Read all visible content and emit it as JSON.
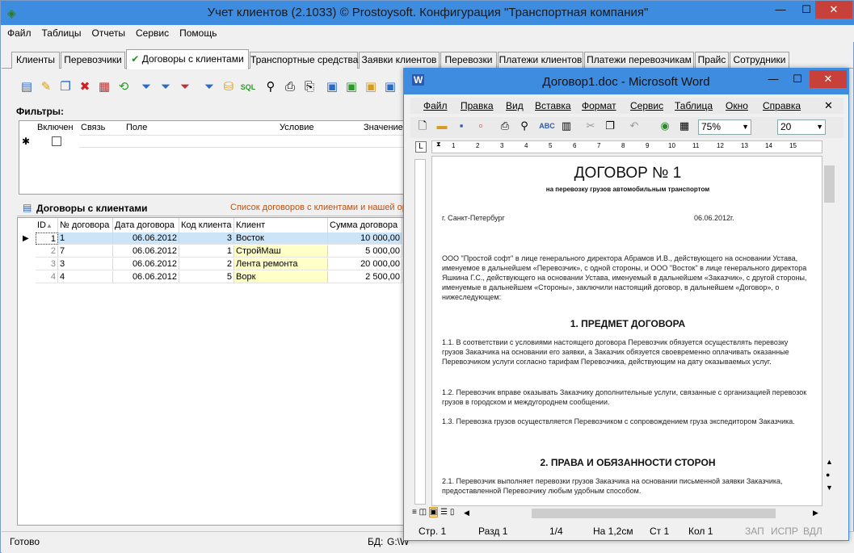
{
  "main_window": {
    "title": "Учет клиентов (2.1033) © Prostoysoft. Конфигурация \"Транспортная компания\"",
    "controls": {
      "minimize": "—",
      "maximize": "☐",
      "close": "✕"
    },
    "menu": [
      "Файл",
      "Таблицы",
      "Отчеты",
      "Сервис",
      "Помощь"
    ],
    "tabs": [
      "Клиенты",
      "Перевозчики",
      "Договоры с клиентами",
      "Транспортные средства",
      "Заявки клиентов",
      "Перевозки",
      "Платежи клиентов",
      "Платежи перевозчикам",
      "Прайс",
      "Сотрудники"
    ],
    "active_tab_check": "✔",
    "filters": {
      "label": "Фильтры:",
      "columns": [
        "Включен",
        "Связь",
        "Поле",
        "Условие",
        "Значение"
      ],
      "new_row_marker": "✱"
    },
    "grid": {
      "title": "Договоры с клиентами",
      "subtitle": "Список договоров с клиентами и нашей ор",
      "columns": [
        "ID",
        "№ договора",
        "Дата договора",
        "Код клиента",
        "Клиент",
        "Сумма договора"
      ],
      "sort_indicator": "▲",
      "rows": [
        {
          "id": "1",
          "num": "1",
          "date": "06.06.2012",
          "code": "3",
          "client": "Восток",
          "sum": "10 000,00"
        },
        {
          "id": "2",
          "num": "7",
          "date": "06.06.2012",
          "code": "1",
          "client": "СтройМаш",
          "sum": "5 000,00"
        },
        {
          "id": "3",
          "num": "3",
          "date": "06.06.2012",
          "code": "2",
          "client": "Лента ремонта",
          "sum": "20 000,00"
        },
        {
          "id": "4",
          "num": "4",
          "date": "06.06.2012",
          "code": "5",
          "client": "Ворк",
          "sum": "2 500,00"
        }
      ],
      "current_row_marker": "▶"
    },
    "status": {
      "ready": "Готово",
      "db_label": "БД:",
      "db_value": "G:\\W"
    }
  },
  "word_window": {
    "title": "Договор1.doc - Microsoft Word",
    "menu": [
      "Файл",
      "Правка",
      "Вид",
      "Вставка",
      "Формат",
      "Сервис",
      "Таблица",
      "Окно",
      "Справка"
    ],
    "zoom": "75%",
    "font_size": "20",
    "ruler_numbers": [
      "1",
      "2",
      "3",
      "4",
      "5",
      "6",
      "7",
      "8",
      "9",
      "10",
      "11",
      "12",
      "13",
      "14",
      "15"
    ],
    "document": {
      "title": "ДОГОВОР № 1",
      "subtitle": "на перевозку грузов автомобильным транспортом",
      "city": "г. Санкт-Петербург",
      "date": "06.06.2012г.",
      "preamble": "ООО \"Простой софт\" в лице генерального директора Абрамов И.В., действующего на основании Устава, именуемое в дальнейшем «Перевозчик», с одной стороны, и ООО \"Восток\" в лице генерального директора Яшкина Г.С., действующего на основании Устава, именуемый в дальнейшем «Заказчик», с другой стороны, именуемые в дальнейшем «Стороны», заключили настоящий договор, в дальнейшем «Договор», о нижеследующем:",
      "section1": "1. ПРЕДМЕТ ДОГОВОРА",
      "p11": "1.1. В соответствии с условиями настоящего договора Перевозчик обязуется осуществлять перевозку грузов Заказчика на основании его заявки, а Заказчик обязуется своевременно оплачивать оказанные Перевозчиком услуги согласно тарифам Перевозчика, действующим на дату оказываемых услуг.",
      "p12": "1.2. Перевозчик вправе оказывать Заказчику дополнительные услуги, связанные с организацией перевозок грузов в городском и междугороднем сообщении.",
      "p13": "1.3. Перевозка грузов осуществляется Перевозчиком с сопровождением груза экспедитором Заказчика.",
      "section2": "2. ПРАВА И ОБЯЗАННОСТИ СТОРОН",
      "p21": "2.1. Перевозчик выполняет перевозки грузов Заказчика на основании письменной заявки Заказчика, предоставленной Перевозчику любым удобным способом."
    },
    "status": {
      "page": "Стр. 1",
      "section": "Разд 1",
      "pages": "1/4",
      "at": "На 1,2см",
      "line": "Ст 1",
      "col": "Кол 1",
      "rec": "ЗАП",
      "trk": "ИСПР",
      "ext": "ВДЛ"
    }
  },
  "colors": {
    "titlebar": "#3d8ce0",
    "close": "#c7403a",
    "highlight": "#ffffc8",
    "selected_row": "#cce4f7"
  }
}
